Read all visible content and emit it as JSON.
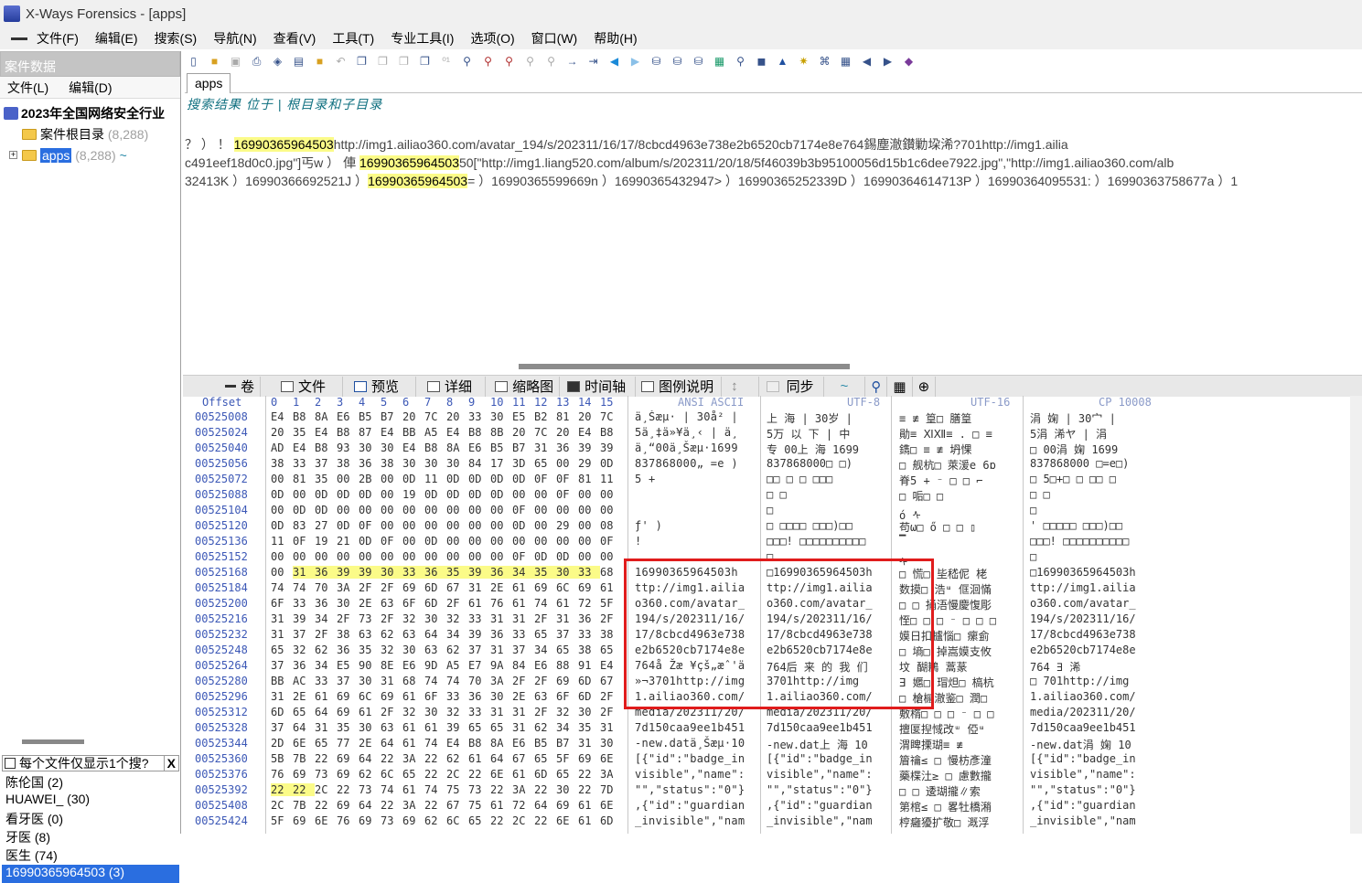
{
  "window": {
    "title": "X-Ways Forensics - [apps]"
  },
  "menu": [
    "文件(F)",
    "编辑(E)",
    "搜索(S)",
    "导航(N)",
    "查看(V)",
    "工具(T)",
    "专业工具(I)",
    "选项(O)",
    "窗口(W)",
    "帮助(H)"
  ],
  "case": {
    "header": "案件数据",
    "menu": [
      "文件(L)",
      "编辑(D)"
    ],
    "root": "2023年全国网络安全行业",
    "nodes": [
      {
        "label": "案件根目录",
        "count": "(8,288)"
      },
      {
        "label": "apps",
        "count": "(8,288)"
      }
    ]
  },
  "filter": {
    "label": "每个文件仅显示1个搜?",
    "close": "X"
  },
  "keywords": [
    "陈伦国 (2)",
    "HUAWEI_ (30)",
    "看牙医 (0)",
    "牙医 (8)",
    "医生 (74)",
    "16990365964503 (3)"
  ],
  "tab": {
    "label": "apps"
  },
  "path": "搜索结果 位于 | 根目录和子目录",
  "results": [
    {
      "pre": "     ？      ）   ！                                  ",
      "hit": "16990365964503",
      "post": "http://img1.ailiao360.com/avatar_194/s/202311/16/17/8cbcd4963e738e2b6520cb7174e8e764錫塵澈鑚勦垜浠?701http://img1.ailia"
    },
    {
      "pre": "c491eef18d0c0.jpg\"]丐w  ）   俥 ",
      "hit": "16990365964503",
      "post": "50[\"http://img1.liang520.com/album/s/202311/20/18/5f46039b3b95100056d15b1c6dee7922.jpg\",\"http://img1.ailiao360.com/alb"
    },
    {
      "pre": "32413K  ）16990366692521J  ）",
      "hit": "16990365964503",
      "post": "=  ）16990365599669n  ）16990365432947>  ）16990365252339D  ）16990364614713P  ）16990364095531:  ）16990363758677a  ）1"
    }
  ],
  "viewtabs": [
    "卷",
    "文件",
    "预览",
    "详细",
    "缩略图",
    "时间轴",
    "图例说明",
    "同步"
  ],
  "hex": {
    "headers": {
      "offset": "Offset",
      "cols": [
        "0",
        "1",
        "2",
        "3",
        "4",
        "5",
        "6",
        "7",
        "8",
        "9",
        "10",
        "11",
        "12",
        "13",
        "14",
        "15"
      ],
      "ansi": "ANSI ASCII",
      "utf8": "UTF-8",
      "utf16": "UTF-16",
      "cp": "CP 10008"
    },
    "rows": [
      {
        "o": "00525008",
        "h": "E4 B8 8A E6 B5 B7 20 7C 20 33 30 E5 B2 81 20 7C",
        "a": "ä¸Šæµ·  | 30å²  |",
        "u": "上 海  | 30岁  |",
        "w": "≡   ≢ 篁□  膳篁",
        "c": "涓 婅  | 30宀  |"
      },
      {
        "o": "00525024",
        "h": "20 35 E4 B8 87 E4 BB A5 E4 B8 8B 20 7C 20 E4 B8",
        "a": " 5ä¸‡ä»¥ä¸‹ | ä¸",
        "u": " 5万 以 下  | 中",
        "w": "勛≡  ⅪⅫ≡ . □ ≡",
        "c": " 5涓 浠ヤ  | 涓"
      },
      {
        "o": "00525040",
        "h": "AD E4 B8 93 30 30 E4 B8 8A E6 B5 B7 31 36 39 39",
        "a": "­ä¸“00ä¸Šæµ·1699",
        "u": "专 00上 海 1699",
        "w": "鐫□ ≡   ≢ 坍惈",
        "c": "□  00涓 婅 1699"
      },
      {
        "o": "00525056",
        "h": "38 33 37 38 36 38 30 30 30 84 17 3D 65 00 29 0D",
        "a": "837868000„ =e )",
        "u": "837868000□ □)",
        "w": "□ 舰杭□ 萊湲e 6ɒ",
        "c": "837868000 □=e□)"
      },
      {
        "o": "00525072",
        "h": "00 81 35 00 2B 00 0D 11 0D 0D 0D 0D 0F 0F 81 11",
        "a": "  5 +",
        "u": "□□ □ □ □□□",
        "w": "脊5 + ⁻ □ □ ⌐",
        "c": "□ 5□+□ □  □□ □"
      },
      {
        "o": "00525088",
        "h": "0D 00 0D 0D 0D 00 19 0D 0D 0D 0D 00 00 0F 00 00",
        "a": "",
        "u": "   □      □",
        "w": "     □ 㖃□ □",
        "c": "   □     □"
      },
      {
        "o": "00525104",
        "h": "00 0D 0D 00 00 00 00 00 00 00 00 0F 00 00 00 00",
        "a": "",
        "u": "        □",
        "w": "ó          ᠰ",
        "c": "          □"
      },
      {
        "o": "00525120",
        "h": "0D 83 27 0D 0F 00 00 00 00 00 00 0D 00 29 00 08",
        "a": " ƒ'           )",
        "u": " □  □□□□ □□□)□□",
        "w": "苟ω□  ő □ □ ▯",
        "c": " ' □□□□□ □□□)□□"
      },
      {
        "o": "00525136",
        "h": "11 0F 19 21 0D 0F 00 0D 00 00 00 00 00 00 00 0F",
        "a": "   !",
        "u": "□□□! □□□□□□□□□□",
        "w": "       ▔",
        "c": "□□□! □□□□□□□□□□"
      },
      {
        "o": "00525152",
        "h": "00 00 00 00 00 00 00 00 00 00 00 0F 0D 0D 00 00",
        "a": "",
        "u": "          □",
        "w": "        ᠰ",
        "c": "          □"
      },
      {
        "o": "00525168",
        "h": "00 31 36 39 39 30 33 36 35 39 36 34 35 30 33 68",
        "a": "16990365964503h",
        "u": "□16990365964503h",
        "w": "□ 慌□ 坒嵇伲 栳",
        "c": "□16990365964503h",
        "hl": [
          1,
          14
        ]
      },
      {
        "o": "00525184",
        "h": "74 74 70 3A 2F 2F 69 6D 67 31 2E 61 69 6C 69 61",
        "a": "ttp://img1.ailia",
        "u": "ttp://img1.ailia",
        "w": "数摸□ 浩ᵚ 㑌洄慲",
        "c": "ttp://img1.ailia"
      },
      {
        "o": "00525200",
        "h": "6F 33 36 30 2E 63 6F 6D 2F 61 76 61 74 61 72 5F",
        "a": "o360.com/avatar_",
        "u": "o360.com/avatar_",
        "w": "□ □ 捅浯慢慶愎彫",
        "c": "o360.com/avatar_"
      },
      {
        "o": "00525216",
        "h": "31 39 34 2F 73 2F 32 30 32 33 31 31 2F 31 36 2F",
        "a": "194/s/202311/16/",
        "u": "194/s/202311/16/",
        "w": "恎□ □ □ ⁻ □ □ □",
        "c": "194/s/202311/16/"
      },
      {
        "o": "00525232",
        "h": "31 37 2F 38 63 62 63 64 34 39 36 33 65 37 33 38",
        "a": "17/8cbcd4963e738",
        "u": "17/8cbcd4963e738",
        "w": "嫫日扣攎惱□ 瘰侴",
        "c": "17/8cbcd4963e738"
      },
      {
        "o": "00525248",
        "h": "65 32 62 36 35 32 30 63 62 37 31 37 34 65 38 65",
        "a": "e2b6520cb7174e8e",
        "u": "e2b6520cb7174e8e",
        "w": "□ 墒□ 掉嵩嫫支攸",
        "c": "e2b6520cb7174e8e"
      },
      {
        "o": "00525264",
        "h": "37 36 34 E5 90 8E E6 9D A5 E7 9A 84 E6 88 91 E4",
        "a": "764å Žæ ¥çš„æˆ'ä",
        "u": "764后 来 的 我 们",
        "w": "坟  醐鶼  蒿蒃",
        "c": "764    ∃     浠"
      },
      {
        "o": "00525280",
        "h": "BB AC 33 37 30 31 68 74 74 70 3A 2F 2F 69 6D 67",
        "a": "»¬3701http://img",
        "u": " 3701http://img",
        "w": "ⴺ 嬺□ 瑁炟□ 槁杭",
        "c": " □ 701http://img"
      },
      {
        "o": "00525296",
        "h": "31 2E 61 69 6C 69 61 6F 33 36 30 2E 63 6F 6D 2F",
        "a": "1.ailiao360.com/",
        "u": "1.ailiao360.com/",
        "w": "□ 槍槭澈鉴□ 潤□",
        "c": "1.ailiao360.com/"
      },
      {
        "o": "00525312",
        "h": "6D 65 64 69 61 2F 32 30 32 33 31 31 2F 32 30 2F",
        "a": "media/202311/20/",
        "u": "media/202311/20/",
        "w": "敷楕□ □ □ ⁻ □ □",
        "c": "media/202311/20/"
      },
      {
        "o": "00525328",
        "h": "37 64 31 35 30 63 61 61 39 65 65 31 62 34 35 31",
        "a": "7d150caa9ee1b451",
        "u": "7d150caa9ee1b451",
        "w": "擅匽揑惐改ᵚ 俹ᵚ",
        "c": "7d150caa9ee1b451"
      },
      {
        "o": "00525344",
        "h": "2D 6E 65 77 2E 64 61 74 E4 B8 8A E6 B5 B7 31 30",
        "a": "-new.datä¸Šæµ·10",
        "u": "-new.dat上 海 10",
        "w": "渭睥搮瑚≡    ≢",
        "c": "-new.dat涓 婅 10"
      },
      {
        "o": "00525360",
        "h": "5B 7B 22 69 64 22 3A 22 62 61 64 67 65 5F 69 6E",
        "a": "[{\"id\":\"badge_in",
        "u": "[{\"id\":\"badge_in",
        "w": "篃禴≤ □ 慢枋彥潼",
        "c": "[{\"id\":\"badge_in"
      },
      {
        "o": "00525376",
        "h": "76 69 73 69 62 6C 65 22 2C 22 6E 61 6D 65 22 3A",
        "a": "visible\",\"name\":",
        "u": "visible\",\"name\":",
        "w": "藥楪汢≥ □ 慮數攏",
        "c": "visible\",\"name\":"
      },
      {
        "o": "00525392",
        "h": "22 22 2C 22 73 74 61 74 75 73 22 3A 22 30 22 7D",
        "a": "\"\",\"status\":\"0\"}",
        "u": "\"\",\"status\":\"0\"}",
        "w": "□ □ 逶瑚攏∥索",
        "c": "\"\",\"status\":\"0\"}",
        "hl": [
          0,
          1
        ]
      },
      {
        "o": "00525408",
        "h": "2C 7B 22 69 64 22 3A 22 67 75 61 72 64 69 61 6E",
        "a": ",{\"id\":\"guardian",
        "u": ",{\"id\":\"guardian",
        "w": "第棺≤ □ 畧牡橋潲",
        "c": ",{\"id\":\"guardian"
      },
      {
        "o": "00525424",
        "h": "5F 69 6E 76 69 73 69 62 6C 65 22 2C 22 6E 61 6D",
        "a": "_invisible\",\"nam",
        "u": "_invisible\",\"nam",
        "w": "梈癰獶扩敬□ 溉浮",
        "c": "_invisible\",\"nam"
      }
    ]
  }
}
